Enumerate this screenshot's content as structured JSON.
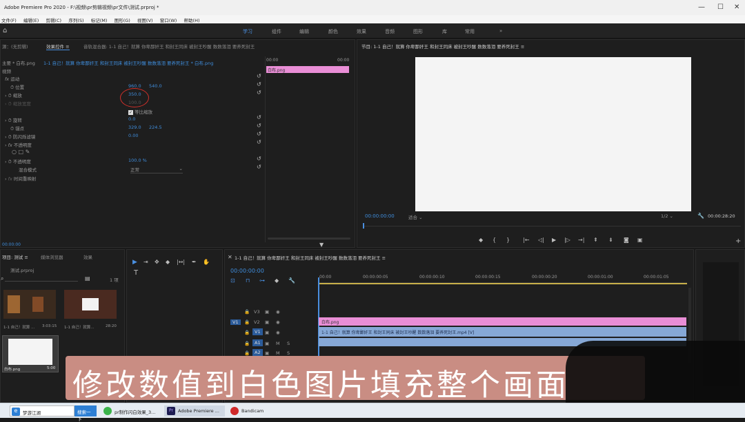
{
  "window": {
    "title": "Adobe Premiere Pro 2020 - F:\\视频\\pr剪辑视频\\pr文件\\测试.prproj *",
    "min": "—",
    "max": "☐",
    "close": "✕"
  },
  "menubar": [
    "文件(F)",
    "编辑(E)",
    "剪辑(C)",
    "序列(S)",
    "标记(M)",
    "图形(G)",
    "视图(V)",
    "窗口(W)",
    "帮助(H)"
  ],
  "workspaces": [
    "学习",
    "组件",
    "编辑",
    "颜色",
    "效果",
    "音频",
    "图形",
    "库",
    "常用",
    "»"
  ],
  "effect_controls": {
    "tabs": [
      "源：(无剪辑)",
      "效果控件 ≡",
      "音轨混合器: 1-1 自己！就算 你卑鄙奸王 和封王同床 被封王吵醒 数数落泪 要养死封王"
    ],
    "source_label": "主要 * 白布.png",
    "clip_path": "1-1 自己！就算 你卑鄙奸王 和封王同床 被封王吵醒 数数落泪 要养死封王 * 白布.png",
    "timecode_left": "00:00",
    "timecode_right": "00:00",
    "clip_bar": "白布.png",
    "section_video": "视频",
    "motion": "运动",
    "position_label": "位置",
    "position_x": "960.0",
    "position_y": "540.0",
    "scale_label": "缩放",
    "scale_value": "350.0",
    "scale_width_label": "缩放宽度",
    "scale_width_value": "100.0",
    "uniform_label": "等比缩放",
    "rotation_label": "旋转",
    "rotation_value": "0.0",
    "anchor_label": "锚点",
    "anchor_x": "329.0",
    "anchor_y": "224.5",
    "antiflicker_label": "防闪烁滤镜",
    "antiflicker_value": "0.00",
    "opacity_section": "不透明度",
    "opacity_label": "不透明度",
    "opacity_value": "100.0 %",
    "blend_label": "混合模式",
    "blend_value": "正常",
    "time_remap": "时间重映射",
    "bottom_time": "00:00:00"
  },
  "program": {
    "title": "节目: 1-1 自己！就算 你卑鄙奸王 和封王同床 被封王吵醒 数数落泪 要养死封王 ≡",
    "timecode": "00:00:00:00",
    "fit": "适合",
    "quality": "1/2",
    "duration": "00:00:28:20"
  },
  "project": {
    "tabs": [
      "项目: 测试 ≡",
      "媒体浏览器",
      "效果"
    ],
    "name": "测试.prproj",
    "count": "1 项",
    "items": [
      {
        "name": "1-1 自己！就算 ...",
        "dur": "3:03:15"
      },
      {
        "name": "1-1 自己！就算...",
        "dur": "28:20"
      },
      {
        "name": "白布.png",
        "dur": "5:00"
      }
    ]
  },
  "timeline": {
    "title": "1-1 自己！就算 你卑鄙奸王 和封王同床 被封王吵醒 数数落泪 要养死封王 ≡",
    "timecode": "00:00:00:00",
    "ruler": [
      "00:00",
      "00:00:00:05",
      "00:00:00:10",
      "00:00:00:15",
      "00:00:00:20",
      "00:00:01:00",
      "00:00:01:05"
    ],
    "tracks": [
      "V3",
      "V2",
      "V1",
      "A1",
      "A2"
    ],
    "clip_v2": "白布.png",
    "clip_v1": "1-1 自己！就算 你卑鄙奸王 和封王同床 被封王吵醒 数数落泪 要养死封王.mp4 [V]"
  },
  "subtitle": "修改数值到白色图片填充整个画面",
  "taskbar": {
    "search": "梦游江湖",
    "search_btn": "搜索一下",
    "items": [
      "pr制作闪白效果_3...",
      "Adobe Premiere ...",
      "Bandicam"
    ]
  },
  "colors": {
    "accent": "#4a8fe0",
    "pink_clip": "#e98ed6",
    "blue_clip": "#86a8d6",
    "subtitle_bg": "#c98d83",
    "annotation": "#d0302a"
  }
}
